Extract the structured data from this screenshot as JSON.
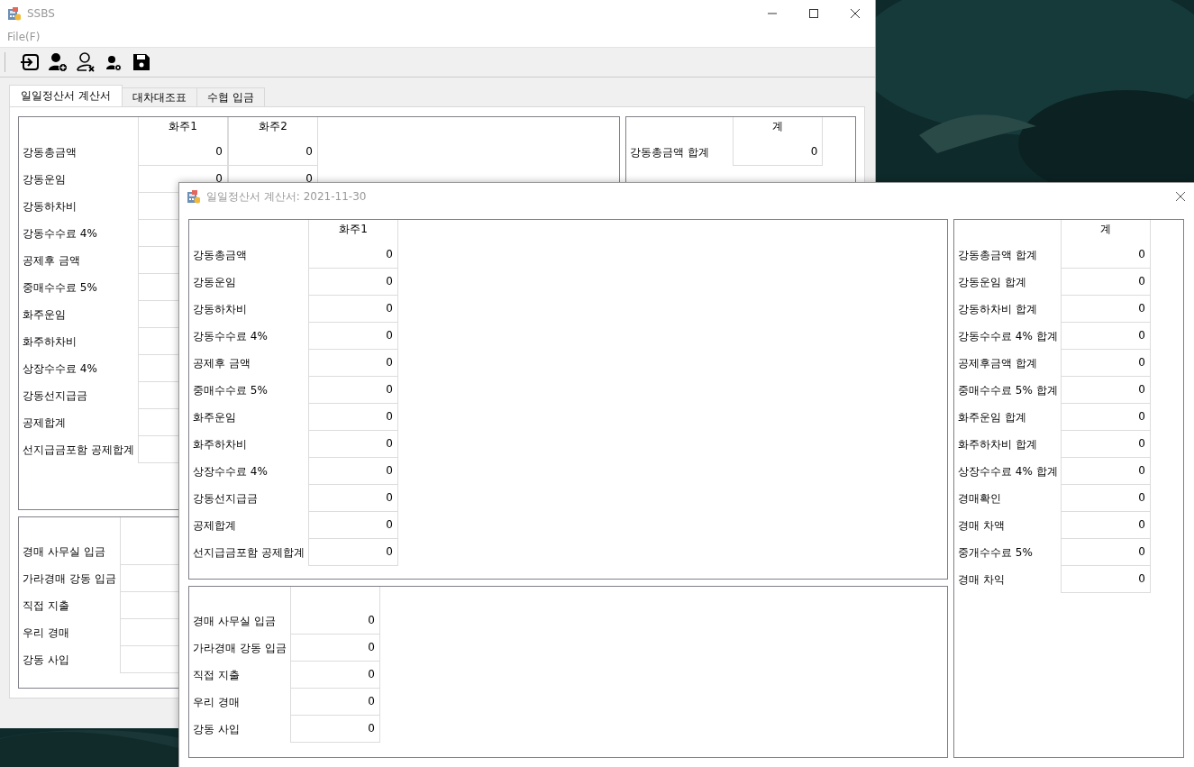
{
  "main_window": {
    "title": "SSBS",
    "menu": [
      "File(F)"
    ],
    "tabs": [
      {
        "label": "일일정산서 계산서",
        "selected": true
      },
      {
        "label": "대차대조표",
        "selected": false
      },
      {
        "label": "수협 입금",
        "selected": false
      }
    ],
    "owner_table": {
      "columns": [
        "화주1",
        "화주2"
      ],
      "rows": [
        {
          "label": "강동총금액",
          "values": [
            "0",
            "0"
          ]
        },
        {
          "label": "강동운임",
          "values": [
            "0",
            "0"
          ]
        },
        {
          "label": "강동하차비"
        },
        {
          "label": "강동수수료 4%"
        },
        {
          "label": "공제후 금액"
        },
        {
          "label": "중매수수료 5%"
        },
        {
          "label": "화주운임"
        },
        {
          "label": "화주하차비"
        },
        {
          "label": "상장수수료 4%"
        },
        {
          "label": "강동선지급금"
        },
        {
          "label": "공제합계"
        },
        {
          "label": "선지급금포함 공제합계"
        }
      ]
    },
    "totals_table": {
      "columns": [
        "계"
      ],
      "rows": [
        {
          "label": "강동총금액 합계",
          "values": [
            "0"
          ]
        }
      ]
    },
    "deposit_table": {
      "rows": [
        {
          "label": "경매 사무실 입금"
        },
        {
          "label": "가라경매 강동 입금"
        },
        {
          "label": "직접 지출"
        },
        {
          "label": "우리 경매"
        },
        {
          "label": "강동 사입"
        }
      ]
    }
  },
  "dialog": {
    "title": "일일정산서 계산서: 2021-11-30",
    "owner_table": {
      "columns": [
        "화주1"
      ],
      "rows": [
        {
          "label": "강동총금액",
          "values": [
            "0"
          ]
        },
        {
          "label": "강동운임",
          "values": [
            "0"
          ]
        },
        {
          "label": "강동하차비",
          "values": [
            "0"
          ]
        },
        {
          "label": "강동수수료 4%",
          "values": [
            "0"
          ]
        },
        {
          "label": "공제후 금액",
          "values": [
            "0"
          ]
        },
        {
          "label": "중매수수료 5%",
          "values": [
            "0"
          ]
        },
        {
          "label": "화주운임",
          "values": [
            "0"
          ]
        },
        {
          "label": "화주하차비",
          "values": [
            "0"
          ]
        },
        {
          "label": "상장수수료 4%",
          "values": [
            "0"
          ]
        },
        {
          "label": "강동선지급금",
          "values": [
            "0"
          ]
        },
        {
          "label": "공제합계",
          "values": [
            "0"
          ]
        },
        {
          "label": "선지급금포함 공제합계",
          "values": [
            "0"
          ]
        }
      ]
    },
    "deposit_table": {
      "rows": [
        {
          "label": "경매 사무실 입금",
          "values": [
            "0"
          ]
        },
        {
          "label": "가라경매 강동 입금",
          "values": [
            "0"
          ]
        },
        {
          "label": "직접 지출",
          "values": [
            "0"
          ]
        },
        {
          "label": "우리 경매",
          "values": [
            "0"
          ]
        },
        {
          "label": "강동 사입",
          "values": [
            "0"
          ]
        }
      ]
    },
    "totals_table": {
      "columns": [
        "계"
      ],
      "rows": [
        {
          "label": "강동총금액 합계",
          "values": [
            "0"
          ]
        },
        {
          "label": "강동운임 합계",
          "values": [
            "0"
          ]
        },
        {
          "label": "강동하차비 합계",
          "values": [
            "0"
          ]
        },
        {
          "label": "강동수수료 4% 합계",
          "values": [
            "0"
          ]
        },
        {
          "label": "공제후금액 합계",
          "values": [
            "0"
          ]
        },
        {
          "label": "중매수수료 5% 합계",
          "values": [
            "0"
          ]
        },
        {
          "label": "화주운임 합계",
          "values": [
            "0"
          ]
        },
        {
          "label": "화주하차비 합계",
          "values": [
            "0"
          ]
        },
        {
          "label": "상장수수료 4% 합계",
          "values": [
            "0"
          ]
        },
        {
          "label": "경매확인",
          "values": [
            "0"
          ]
        },
        {
          "label": "경매 차액",
          "values": [
            "0"
          ]
        },
        {
          "label": "중개수수료 5%",
          "values": [
            "0"
          ]
        },
        {
          "label": "경매 차익",
          "values": [
            "0"
          ]
        }
      ]
    }
  }
}
